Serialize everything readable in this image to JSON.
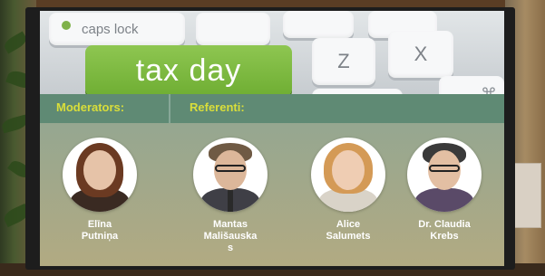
{
  "slide": {
    "keys": {
      "caps_lock": "caps lock",
      "tax_day": "tax day",
      "z": "Z",
      "x": "X",
      "cmd": "⌘"
    },
    "header": {
      "moderators_label": "Moderators:",
      "referents_label": "Referenti:"
    },
    "people": [
      {
        "name": "Elīna\nPutniņa",
        "role": "moderator"
      },
      {
        "name": "Mantas\nMališauska\ns",
        "role": "referent"
      },
      {
        "name": "Alice\nSalumets",
        "role": "referent"
      },
      {
        "name": "Dr. Claudia\nKrebs",
        "role": "referent"
      }
    ]
  },
  "colors": {
    "tax_key": "#7fb840",
    "header_text": "#d9de3a",
    "slide_bg": "#8ea694"
  }
}
